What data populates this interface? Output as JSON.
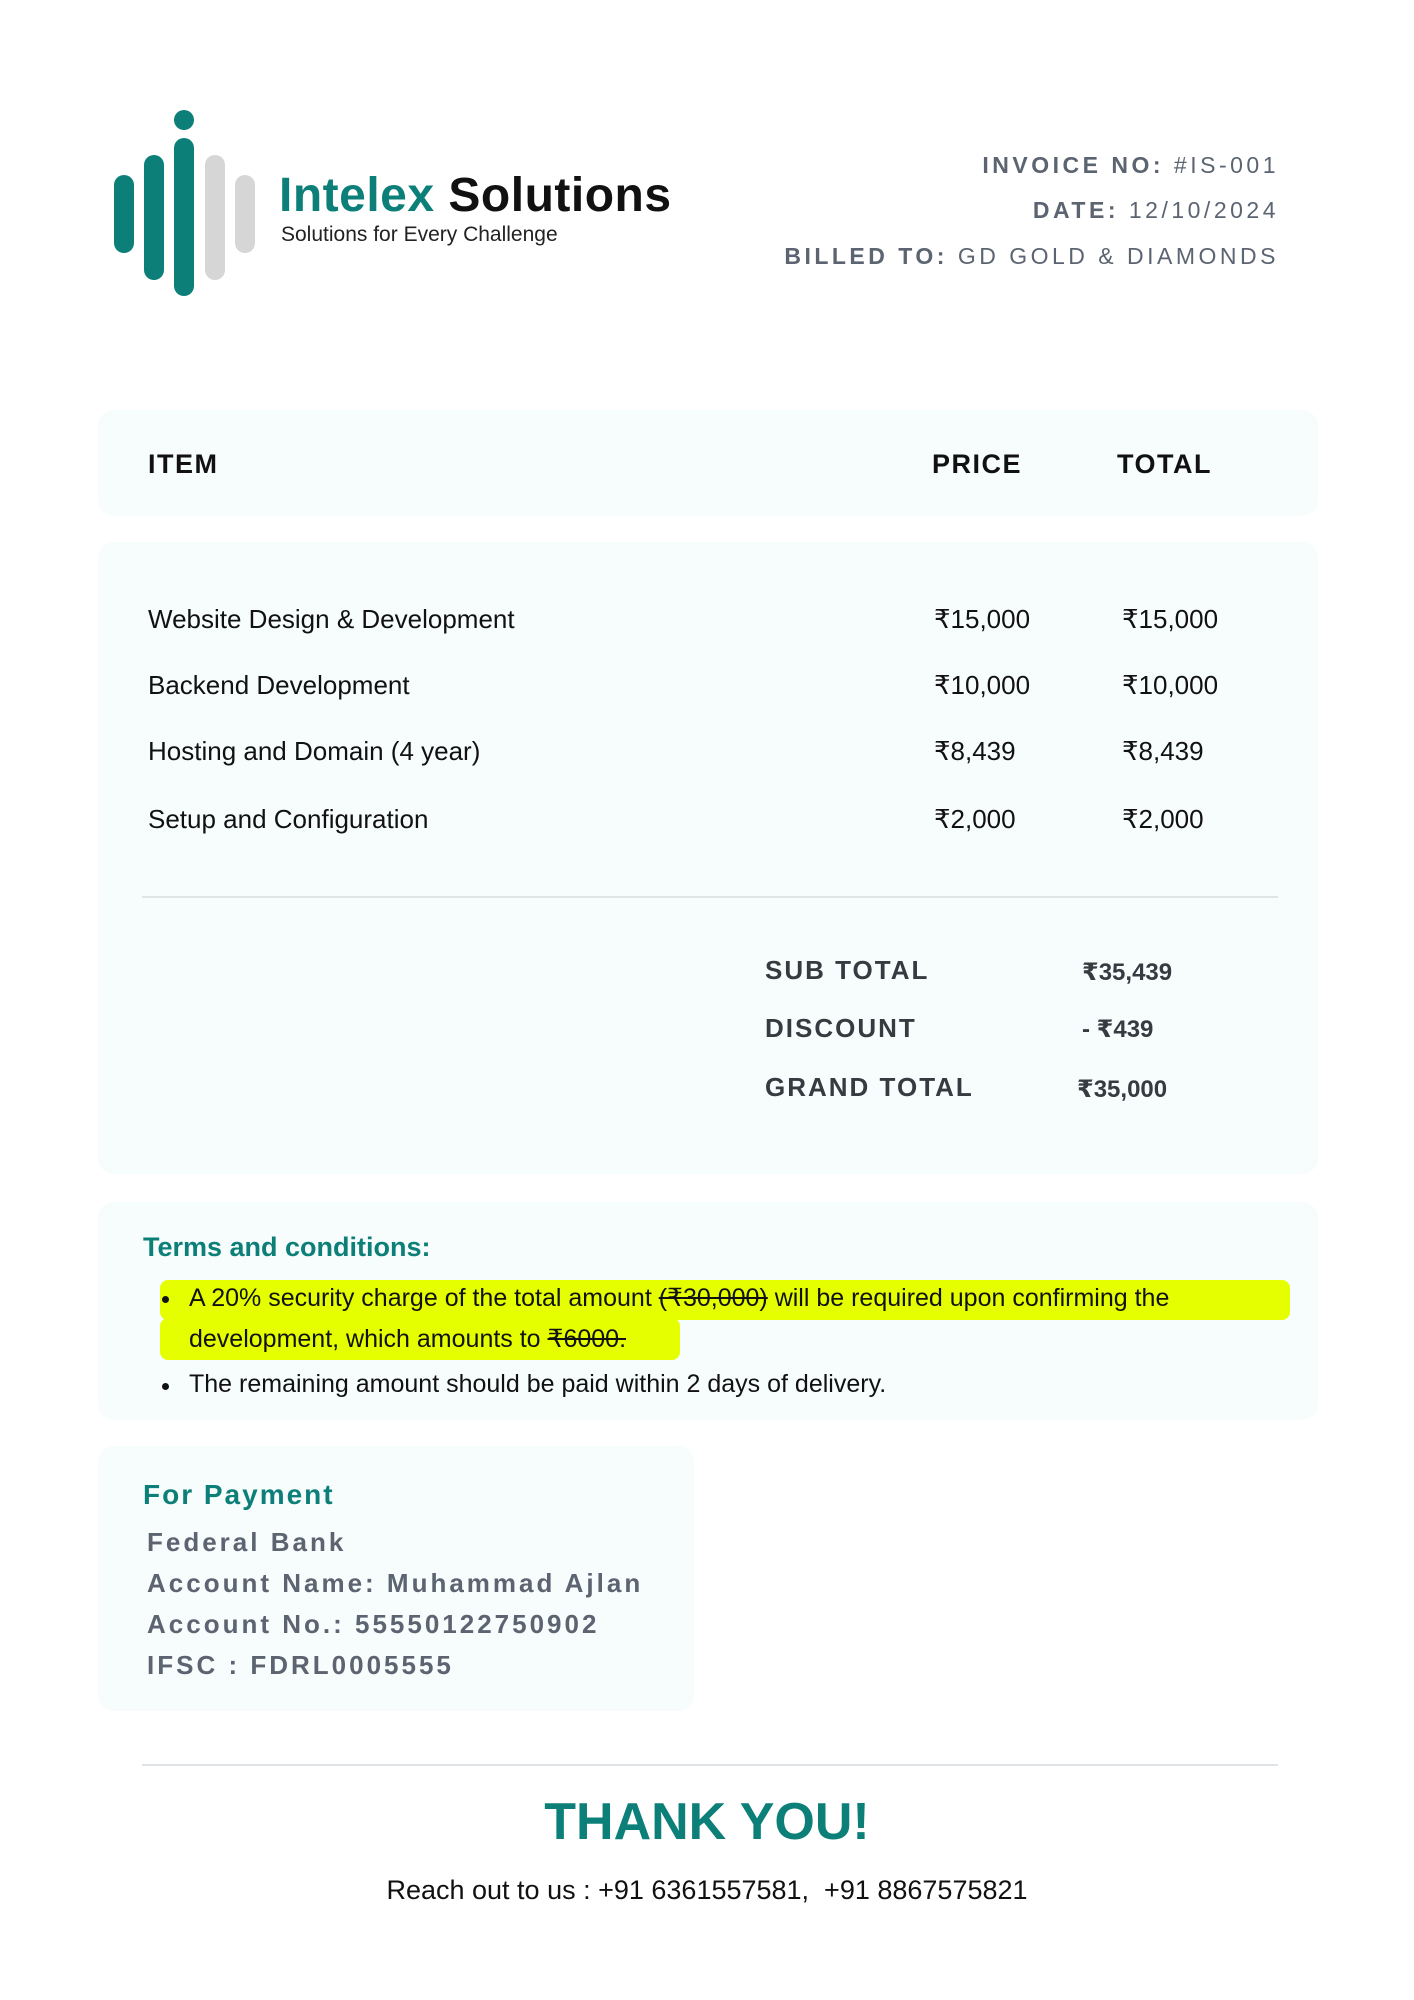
{
  "company": {
    "name_part1": "Intelex",
    "name_part2": " Solutions",
    "tagline": "Solutions for Every Challenge",
    "logo_icon": "bars-logo-icon",
    "brand_color": "#0d7f79"
  },
  "invoice": {
    "number_label": "INVOICE NO:",
    "number_value": " #IS-001",
    "date_label": "DATE:",
    "date_value": " 12/10/2024",
    "billed_label": "BILLED TO:",
    "billed_value": " GD GOLD & DIAMONDS"
  },
  "table": {
    "headers": [
      "ITEM",
      "PRICE",
      "TOTAL"
    ],
    "rows": [
      {
        "item": "Website Design & Development",
        "price": "₹15,000",
        "total": "₹15,000"
      },
      {
        "item": "Backend Development",
        "price": "₹10,000",
        "total": "₹10,000"
      },
      {
        "item": "Hosting and Domain (4 year)",
        "price": "₹8,439",
        "total": "₹8,439"
      },
      {
        "item": "Setup and Configuration",
        "price": "₹2,000",
        "total": "₹2,000"
      }
    ]
  },
  "totals": {
    "subtotal_label": "SUB TOTAL",
    "subtotal_value": "₹35,439",
    "discount_label": "DISCOUNT",
    "discount_value": "- ₹439",
    "grand_label": "GRAND TOTAL",
    "grand_value": "₹35,000"
  },
  "terms": {
    "title": "Terms and conditions:",
    "line1_a": "A 20% security charge of the total amount ",
    "line1_strike": "(₹30,000)",
    "line1_b": " will be required upon confirming the",
    "line2_a": "development, which amounts to ",
    "line2_strike": "₹6000.",
    "line3": "The remaining amount should be paid within 2 days of delivery.",
    "highlight_color": "#e5ff00"
  },
  "payment": {
    "title": "For Payment",
    "bank": "Federal Bank",
    "account_name": "Account Name: Muhammad Ajlan",
    "account_no": "Account No.: 55550122750902",
    "ifsc": "IFSC : FDRL0005555"
  },
  "footer": {
    "thanks": "THANK YOU!",
    "contact": "Reach out to us : +91 6361557581,  +91 8867575821"
  }
}
